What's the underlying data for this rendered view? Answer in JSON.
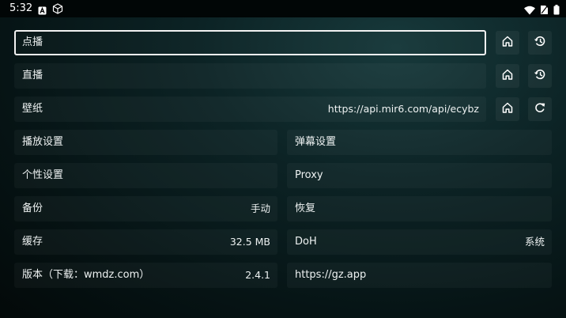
{
  "status_bar": {
    "time": "5:32",
    "icons": [
      "notification-a-icon",
      "package-icon",
      "wifi-icon",
      "no-sim-icon",
      "battery-icon"
    ]
  },
  "rows": {
    "vod": {
      "label": "点播"
    },
    "live": {
      "label": "直播"
    },
    "wallpaper": {
      "label": "壁纸",
      "value": "https://api.mir6.com/api/ecybz"
    }
  },
  "settings": {
    "playback": {
      "label": "播放设置"
    },
    "danmaku": {
      "label": "弹幕设置"
    },
    "personal": {
      "label": "个性设置"
    },
    "proxy": {
      "label": "Proxy"
    },
    "backup": {
      "label": "备份",
      "value": "手动"
    },
    "restore": {
      "label": "恢复"
    },
    "cache": {
      "label": "缓存",
      "value": "32.5 MB"
    },
    "doh": {
      "label": "DoH",
      "value": "系统"
    },
    "version": {
      "label": "版本（下载：wmdz.com）",
      "value": "2.4.1"
    },
    "website": {
      "label": "https://gz.app"
    }
  },
  "colors": {
    "accent": "#f2f2f2",
    "background": "#0c2325"
  }
}
